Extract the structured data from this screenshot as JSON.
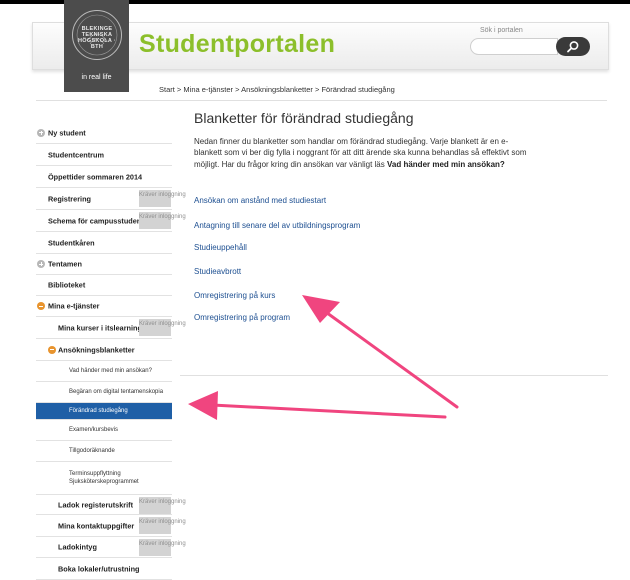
{
  "header": {
    "logo_seal_text": "BLEKINGE TEKNISKA HÖGSKOLA · BTH",
    "logo_tagline": "in real life",
    "site_title": "Studentportalen",
    "search": {
      "label": "Sök i portalen",
      "value": "",
      "button_icon": "search-icon"
    }
  },
  "breadcrumb": [
    "Start",
    "Mina e-tjänster",
    "Ansökningsblanketter",
    "Förändrad studiegång"
  ],
  "breadcrumb_separator": ">",
  "sidebar": [
    {
      "label": "Ny student",
      "icon": "plus-icon"
    },
    {
      "label": "Studentcentrum"
    },
    {
      "label": "Öppettider sommaren 2014"
    },
    {
      "label": "Registrering",
      "badge": "Kräver inloggning"
    },
    {
      "label": "Schema för campusstudenter",
      "badge": "Kräver inloggning"
    },
    {
      "label": "Studentkåren"
    },
    {
      "label": "Tentamen",
      "icon": "plus-icon"
    },
    {
      "label": "Biblioteket"
    },
    {
      "label": "Mina e-tjänster",
      "icon": "minus-icon"
    },
    {
      "label": "Mina kurser i itslearning",
      "badge": "Kräver inloggning"
    },
    {
      "label": "Ansökningsblanketter",
      "icon": "minus-icon"
    },
    {
      "label": "Vad händer med min ansökan?"
    },
    {
      "label": "Begäran om digital tentamenskopia"
    },
    {
      "label": "Förändrad studiegång",
      "active": true
    },
    {
      "label": "Examen/kursbevis"
    },
    {
      "label": "Tillgodoräknande"
    },
    {
      "label": "Terminsuppflyttning Sjuksköterskeprogrammet"
    },
    {
      "label": "Ladok registerutskrift",
      "badge": "Kräver inloggning"
    },
    {
      "label": "Mina kontaktuppgifter",
      "badge": "Kräver inloggning"
    },
    {
      "label": "Ladokintyg",
      "badge": "Kräver inloggning"
    },
    {
      "label": "Boka lokaler/utrustning"
    }
  ],
  "main": {
    "title": "Blanketter för förändrad studiegång",
    "intro_text": "Nedan finner du blanketter som handlar om förändrad studiegång. Varje blankett är en e-blankett som vi ber dig fylla i noggrant för att ditt ärende ska kunna behandlas så effektivt som möjligt. Har du frågor kring din ansökan var vänligt läs",
    "intro_link": "Vad händer med min ansökan?",
    "links": [
      "Ansökan om anstånd med studiestart",
      "Antagning till senare del av utbildningsprogram",
      "Studieuppehåll",
      "Studieavbrott",
      "Omregistrering på kurs",
      "Omregistrering på program"
    ]
  },
  "colors": {
    "brand_green": "#8cbf2b",
    "active_blue": "#1f5fa6",
    "link_blue": "#1d4f91",
    "annotation_arrow": "#f0457f",
    "bullet_orange": "#e8942e"
  }
}
